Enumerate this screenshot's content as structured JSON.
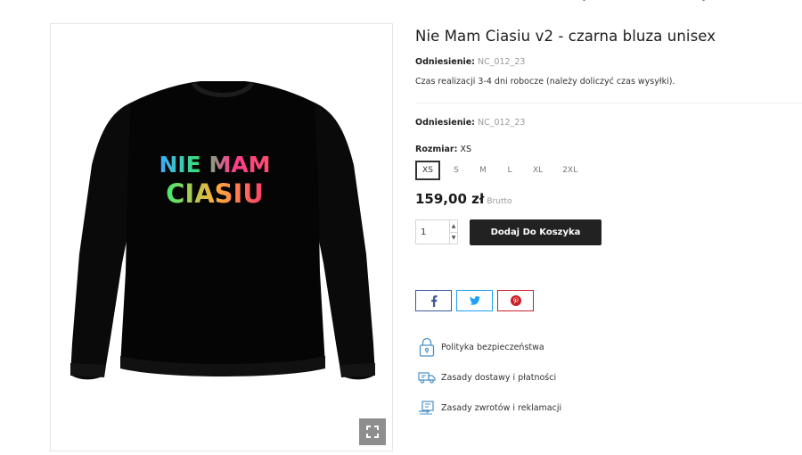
{
  "product": {
    "title": "Nie Mam Ciasiu v2 - czarna bluza unisex",
    "reference_label": "Odniesienie:",
    "reference_value": "NC_012_23",
    "lead_time": "Czas realizacji 3-4 dni robocze (należy doliczyć czas wysyłki).",
    "print_line1": "NIE MAM",
    "print_line2": "CIASIU"
  },
  "size": {
    "label": "Rozmiar:",
    "selected": "XS",
    "options": [
      "XS",
      "S",
      "M",
      "L",
      "XL",
      "2XL"
    ]
  },
  "price": {
    "amount": "159,00 zł",
    "tax_label": "Brutto"
  },
  "cart": {
    "quantity": "1",
    "add_button": "Dodaj Do Koszyka"
  },
  "share": {
    "icons": [
      "facebook-icon",
      "twitter-icon",
      "pinterest-icon"
    ]
  },
  "policies": [
    {
      "label": "Polityka bezpieczeństwa",
      "icon": "lock-icon"
    },
    {
      "label": "Zasady dostawy i płatności",
      "icon": "truck-icon"
    },
    {
      "label": "Zasady zwrotów i reklamacji",
      "icon": "return-icon"
    }
  ],
  "colors": {
    "button_bg": "#222222",
    "facebook": "#3b5998",
    "twitter": "#1da1f2",
    "pinterest": "#cb2027",
    "policy_icon": "#4a90c8"
  }
}
